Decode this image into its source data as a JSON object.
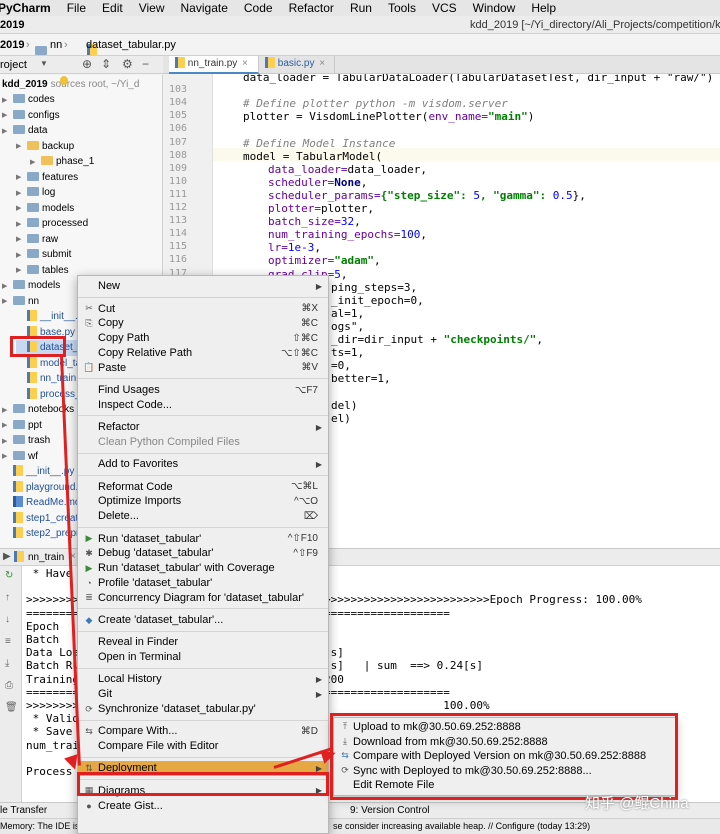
{
  "menubar": {
    "app": "PyCharm",
    "items": [
      "File",
      "Edit",
      "View",
      "Navigate",
      "Code",
      "Refactor",
      "Run",
      "Tools",
      "VCS",
      "Window",
      "Help"
    ]
  },
  "titlebar": {
    "project": "2019",
    "path": "kdd_2019 [~/Yi_directory/Ali_Projects/competition/kdd"
  },
  "navbar": {
    "project": "2019",
    "folder": "nn",
    "file": "dataset_tabular.py"
  },
  "project_panel": {
    "label": "roject",
    "root": "kdd_2019",
    "root_note": "sources root,  ~/Yi_d"
  },
  "tabs": [
    {
      "label": "nn_train.py",
      "active": true
    },
    {
      "label": "basic.py",
      "active": false
    }
  ],
  "tree": [
    {
      "name": "codes",
      "depth": 1,
      "type": "folder"
    },
    {
      "name": "configs",
      "depth": 1,
      "type": "folder"
    },
    {
      "name": "data",
      "depth": 1,
      "type": "folder"
    },
    {
      "name": "backup",
      "depth": 2,
      "type": "yfolder"
    },
    {
      "name": "phase_1",
      "depth": 3,
      "type": "yfolder"
    },
    {
      "name": "features",
      "depth": 2,
      "type": "folder"
    },
    {
      "name": "log",
      "depth": 2,
      "type": "folder"
    },
    {
      "name": "models",
      "depth": 2,
      "type": "folder"
    },
    {
      "name": "processed",
      "depth": 2,
      "type": "folder"
    },
    {
      "name": "raw",
      "depth": 2,
      "type": "folder"
    },
    {
      "name": "submit",
      "depth": 2,
      "type": "folder"
    },
    {
      "name": "tables",
      "depth": 2,
      "type": "folder"
    },
    {
      "name": "models",
      "depth": 1,
      "type": "folder"
    },
    {
      "name": "nn",
      "depth": 1,
      "type": "folder"
    },
    {
      "name": "__init__.py",
      "depth": 2,
      "type": "py"
    },
    {
      "name": "base.py",
      "depth": 2,
      "type": "py"
    },
    {
      "name": "dataset_ta",
      "depth": 2,
      "type": "py",
      "selected": true
    },
    {
      "name": "model_tab",
      "depth": 2,
      "type": "py"
    },
    {
      "name": "nn_train.p",
      "depth": 2,
      "type": "py"
    },
    {
      "name": "process_t",
      "depth": 2,
      "type": "py"
    },
    {
      "name": "notebooks",
      "depth": 1,
      "type": "folder"
    },
    {
      "name": "ppt",
      "depth": 1,
      "type": "folder"
    },
    {
      "name": "trash",
      "depth": 1,
      "type": "folder"
    },
    {
      "name": "wf",
      "depth": 1,
      "type": "folder"
    },
    {
      "name": "__init__.py",
      "depth": 1,
      "type": "py"
    },
    {
      "name": "playground.p",
      "depth": 1,
      "type": "py"
    },
    {
      "name": "ReadMe.mo",
      "depth": 1,
      "type": "md"
    },
    {
      "name": "step1_create",
      "depth": 1,
      "type": "py"
    },
    {
      "name": "step2_prepro",
      "depth": 1,
      "type": "py"
    }
  ],
  "editor": {
    "lines": [
      "",
      "103",
      "104",
      "105",
      "106",
      "107",
      "108",
      "109",
      "110",
      "111",
      "112",
      "113",
      "114",
      "115",
      "116",
      "117",
      "118",
      "119",
      "120",
      "121",
      "122",
      "123",
      "124",
      "125",
      "126",
      "127",
      "128",
      "129",
      "130"
    ],
    "code": {
      "l102": "data_loader = TabularDataLoader(TabularDatasetTest, dir_input + \"raw/\")",
      "l104": "# Define plotter python -m visdom.server",
      "l105a": "plotter = VisdomLinePlotter(",
      "l105b": "env_name=",
      "l105c": "\"main\"",
      "l105d": ")",
      "l107": "# Define Model Instance",
      "l108": "model = TabularModel(",
      "l109a": "data_loader=",
      "l109b": "data_loader,",
      "l110a": "scheduler=",
      "l110b": "None",
      "l110c": ",",
      "l111a": "scheduler_params=",
      "l111b": "{\"step_size\": ",
      "l111c": "5",
      "l111d": ", \"gamma\": ",
      "l111e": "0.5",
      "l111f": "},",
      "l112a": "plotter=",
      "l112b": "plotter,",
      "l113a": "batch_size=",
      "l113b": "32",
      "l113c": ",",
      "l114a": "num_training_epochs=",
      "l114b": "100",
      "l114c": ",",
      "l115a": "lr=",
      "l115b": "1e-3",
      "l115c": ",",
      "l116a": "optimizer=",
      "l116b": "\"adam\"",
      "l116c": ",",
      "l117a": "grad_clip=",
      "l117b": "5",
      "l117c": ",",
      "l118": "ping_steps=3,",
      "l119": "_init_epoch=0,",
      "l120": "al=1,",
      "l121": "ogs\",",
      "l122a": "_dir=dir_input + ",
      "l122b": "\"checkpoints/\"",
      "l122c": ",",
      "l123": "ts=1,",
      "l124": "=0,",
      "l125": "better=1,",
      "l127": "del)",
      "l128": "el)"
    }
  },
  "run": {
    "tab": "nn_train"
  },
  "console": [
    " * Have",
    "",
    ">>>>>>>>>>>>>>>>>>>>>>>>>>>>>>>>>>>>>>>>>>>>>>>>>>>>>>>>>>>>>>>>>>>>>>Epoch Progress: 100.00%",
    "================================================================",
    "Epoch                                %",
    "Batch",
    "Data Loa                                    0[s]",
    "Batch Ru                                    1[s]   | sum  ==> 0.24[s]",
    "Training                                    8200",
    "================================================================",
    ">>>>>>>>                                                       100.00%",
    " * Valid",
    " * Save",
    "num_trai",
    "",
    "Process"
  ],
  "statusbar": {
    "left": "le Transfer",
    "version_control": "9: Version Control",
    "memory": "Memory: The IDE is",
    "message": "se consider increasing available heap. // Configure (today 13:29)"
  },
  "context_menu": {
    "items": [
      {
        "label": "New",
        "submenu": true
      },
      {
        "sep": true
      },
      {
        "label": "Cut",
        "shortcut": "⌘X",
        "icon": "scissors-icon"
      },
      {
        "label": "Copy",
        "shortcut": "⌘C",
        "icon": "copy-icon"
      },
      {
        "label": "Copy Path",
        "shortcut": "⇧⌘C"
      },
      {
        "label": "Copy Relative Path",
        "shortcut": "⌥⇧⌘C"
      },
      {
        "label": "Paste",
        "shortcut": "⌘V",
        "icon": "paste-icon"
      },
      {
        "sep": true
      },
      {
        "label": "Find Usages",
        "shortcut": "⌥F7"
      },
      {
        "label": "Inspect Code..."
      },
      {
        "sep": true
      },
      {
        "label": "Refactor",
        "submenu": true
      },
      {
        "label": "Clean Python Compiled Files",
        "disabled": true
      },
      {
        "sep": true
      },
      {
        "label": "Add to Favorites",
        "submenu": true
      },
      {
        "sep": true
      },
      {
        "label": "Reformat Code",
        "shortcut": "⌥⌘L"
      },
      {
        "label": "Optimize Imports",
        "shortcut": "^⌥O"
      },
      {
        "label": "Delete...",
        "shortcut": "⌦"
      },
      {
        "sep": true
      },
      {
        "label": "Run 'dataset_tabular'",
        "shortcut": "^⇧F10",
        "icon": "run-icon"
      },
      {
        "label": "Debug 'dataset_tabular'",
        "shortcut": "^⇧F9",
        "icon": "debug-icon"
      },
      {
        "label": "Run 'dataset_tabular' with Coverage",
        "icon": "coverage-icon"
      },
      {
        "label": "Profile 'dataset_tabular'",
        "icon": "profile-icon"
      },
      {
        "label": "Concurrency Diagram for 'dataset_tabular'",
        "icon": "concurrency-icon"
      },
      {
        "sep": true
      },
      {
        "label": "Create 'dataset_tabular'...",
        "icon": "python-icon"
      },
      {
        "sep": true
      },
      {
        "label": "Reveal in Finder"
      },
      {
        "label": "Open in Terminal"
      },
      {
        "sep": true
      },
      {
        "label": "Local History",
        "submenu": true
      },
      {
        "label": "Git",
        "submenu": true
      },
      {
        "label": "Synchronize 'dataset_tabular.py'",
        "icon": "sync-icon"
      },
      {
        "sep": true
      },
      {
        "label": "Compare With...",
        "shortcut": "⌘D",
        "icon": "compare-icon"
      },
      {
        "label": "Compare File with Editor"
      },
      {
        "sep": true
      },
      {
        "label": "Deployment",
        "submenu": true,
        "highlighted": true,
        "icon": "deployment-icon"
      },
      {
        "sep": true
      },
      {
        "label": "Diagrams",
        "submenu": true,
        "icon": "diagram-icon"
      },
      {
        "label": "Create Gist...",
        "icon": "github-icon"
      }
    ]
  },
  "deployment_submenu": {
    "items": [
      {
        "label": "Upload to mk@30.50.69.252:8888",
        "icon": "upload-icon"
      },
      {
        "label": "Download from mk@30.50.69.252:8888",
        "icon": "download-icon"
      },
      {
        "label": "Compare with Deployed Version on mk@30.50.69.252:8888",
        "icon": "compare-icon"
      },
      {
        "label": "Sync with Deployed to mk@30.50.69.252:8888...",
        "icon": "sync-icon"
      },
      {
        "label": "Edit Remote File"
      }
    ]
  },
  "watermark": "知乎 @鲲China",
  "colors": {
    "highlight": "#e5a843",
    "annotation": "#e02020",
    "selection": "#c9d9f2"
  }
}
